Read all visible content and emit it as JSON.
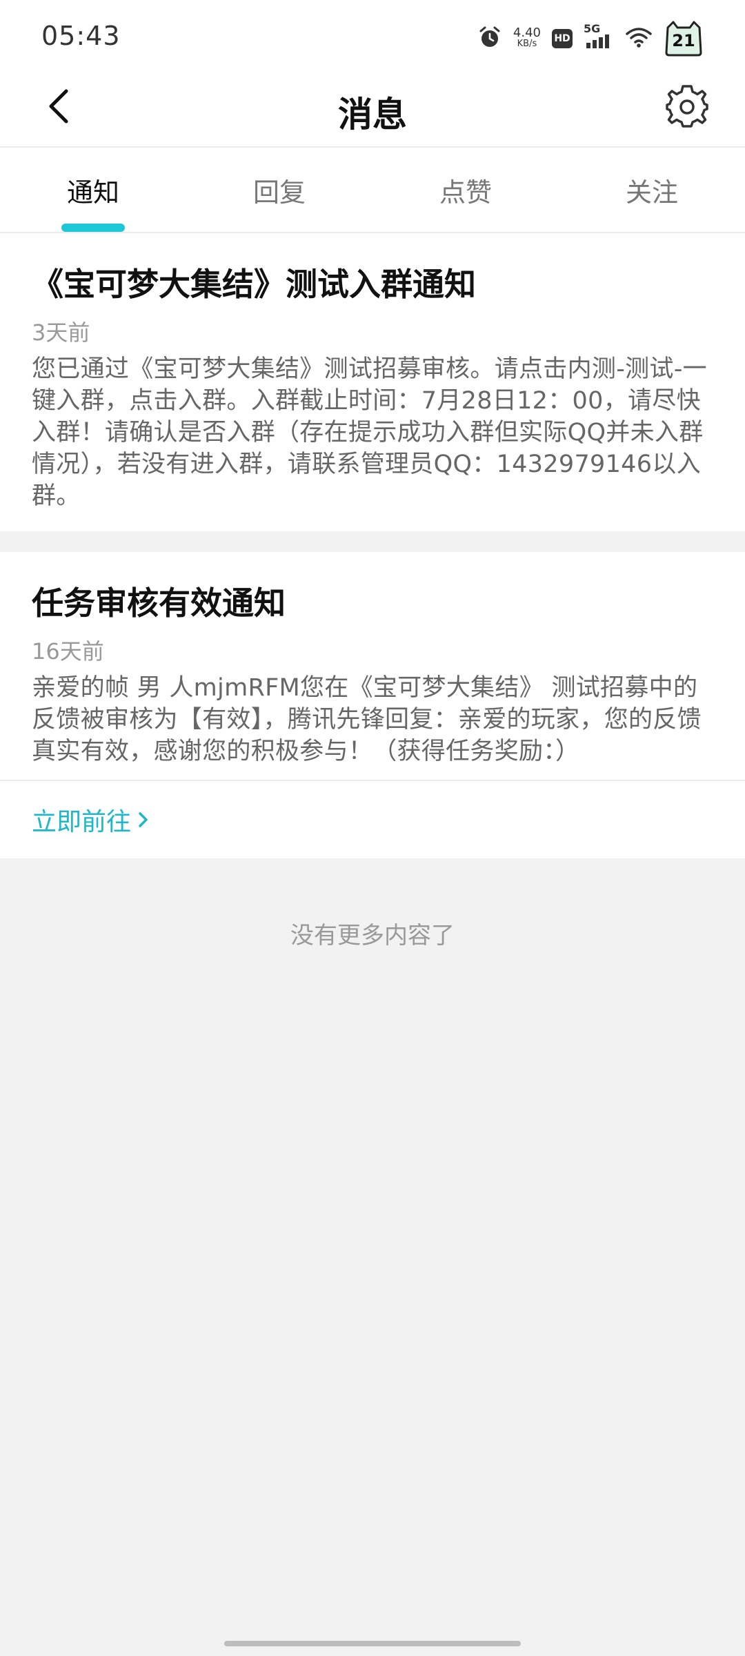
{
  "status_bar": {
    "time": "05:43",
    "net_speed_value": "4.40",
    "net_speed_unit": "KB/s",
    "hd_label": "HD",
    "network_type": "5G",
    "battery_level": "21",
    "icons": [
      "alarm-icon",
      "hd-icon",
      "signal-icon",
      "wifi-icon",
      "battery-icon"
    ]
  },
  "header": {
    "title": "消息",
    "back_icon": "chevron-left-icon",
    "settings_icon": "gear-icon"
  },
  "tabs": [
    {
      "label": "通知",
      "active": true
    },
    {
      "label": "回复",
      "active": false
    },
    {
      "label": "点赞",
      "active": false
    },
    {
      "label": "关注",
      "active": false
    }
  ],
  "notifications": [
    {
      "title": "《宝可梦大集结》测试入群通知",
      "time": "3天前",
      "body": "您已通过《宝可梦大集结》测试招募审核。请点击内测-测试-一键入群，点击入群。入群截止时间：7月28日12：00，请尽快入群！请确认是否入群（存在提示成功入群但实际QQ并未入群情况），若没有进入群，请联系管理员QQ：1432979146以入群。"
    },
    {
      "title": "任务审核有效通知",
      "time": "16天前",
      "body": "亲爱的帧 男 人mjmRFM您在《宝可梦大集结》 测试招募中的反馈被审核为【有效】，腾讯先锋回复：亲爱的玩家，您的反馈真实有效，感谢您的积极参与！（获得任务奖励：）",
      "action_label": "立即前往"
    }
  ],
  "footer": {
    "no_more_text": "没有更多内容了"
  },
  "colors": {
    "accent": "#1cc7d6",
    "link": "#1cb8c8",
    "background": "#f2f2f2"
  }
}
